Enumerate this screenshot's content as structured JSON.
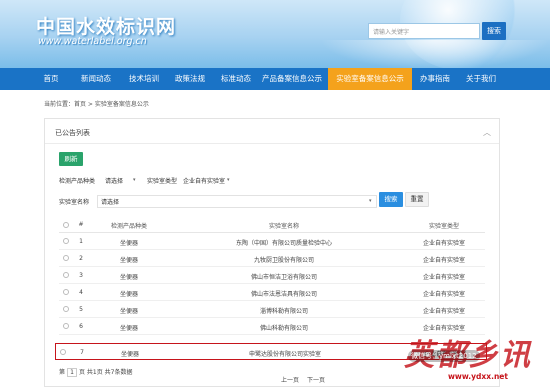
{
  "header": {
    "site_title": "中国水效标识网",
    "site_url": "www.waterlabel.org.cn",
    "search_placeholder": "请输入关键字",
    "search_button": "搜索"
  },
  "nav": {
    "items": [
      "首页",
      "新闻动态",
      "技术培训",
      "政策法规",
      "标准动态",
      "产品备案信息公示",
      "实验室备案信息公示",
      "办事指南",
      "关于我们"
    ],
    "active_index": 6
  },
  "breadcrumb": "当前位置：首页 > 实验室备案信息公示",
  "panel": {
    "title": "已公告列表",
    "chevron": "︿",
    "refresh_button": "刷新"
  },
  "filters": {
    "product_type_label": "检测产品种类",
    "product_type_value": "请选择",
    "lab_type_label": "实验室类型",
    "lab_type_value": "企业自有实验室",
    "lab_name_label": "实验室名称",
    "lab_name_value": "请选择",
    "search_button": "搜索",
    "reset_button": "重置"
  },
  "table": {
    "headers": [
      "检测产品种类",
      "实验室名称",
      "实验室类型"
    ],
    "rows": [
      {
        "no": "1",
        "product": "坐便器",
        "lab": "东陶（中国）有限公司质量检验中心",
        "type": "企业自有实验室"
      },
      {
        "no": "2",
        "product": "坐便器",
        "lab": "九牧厨卫股份有限公司",
        "type": "企业自有实验室"
      },
      {
        "no": "3",
        "product": "坐便器",
        "lab": "佛山市恒洁卫浴有限公司",
        "type": "企业自有实验室"
      },
      {
        "no": "4",
        "product": "坐便器",
        "lab": "佛山市法恩洁具有限公司",
        "type": "企业自有实验室"
      },
      {
        "no": "5",
        "product": "坐便器",
        "lab": "淄博科勒有限公司",
        "type": "企业自有实验室"
      },
      {
        "no": "6",
        "product": "坐便器",
        "lab": "佛山科勒有限公司",
        "type": "企业自有实验室"
      },
      {
        "no": "7",
        "product": "坐便器",
        "lab": "申鹭达股份有限公司实验室",
        "type": "企业自有实验室"
      }
    ],
    "highlight_index": 6
  },
  "pager": {
    "prefix": "第",
    "page": "1",
    "summary": "页 共1页 共7条数据",
    "prev": "上一页",
    "next": "下一页"
  },
  "watermark": {
    "brand": "英都乡讯",
    "wechat": "微信号：ymlxt2012",
    "url": "www.ydxx.net"
  }
}
